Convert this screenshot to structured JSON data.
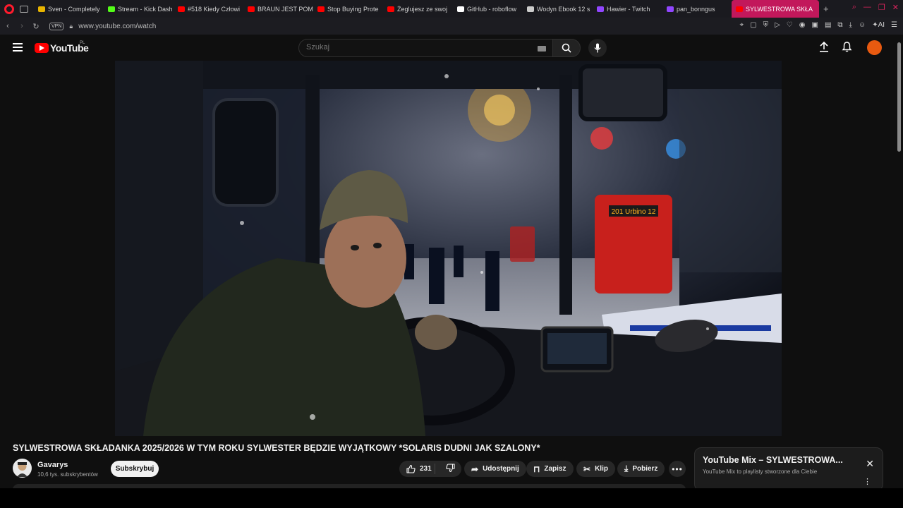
{
  "browser": {
    "tabs": [
      {
        "label": "Sven - Completely",
        "fav": "#e8b400"
      },
      {
        "label": "Stream - Kick Dash",
        "fav": "#53fc18"
      },
      {
        "label": "#518 Kiedy Człowi",
        "fav": "#ff0000"
      },
      {
        "label": "BRAUN JEST POM",
        "fav": "#ff0000"
      },
      {
        "label": "Stop Buying Prote",
        "fav": "#ff0000"
      },
      {
        "label": "Żeglujesz ze swoj",
        "fav": "#ff0000"
      },
      {
        "label": "GitHub - roboflow",
        "fav": "#ffffff"
      },
      {
        "label": "Wodyn Ebook 12 s",
        "fav": "#cccccc"
      },
      {
        "label": "Hawier - Twitch",
        "fav": "#9146ff"
      },
      {
        "label": "pan_bonngus",
        "fav": "#9146ff"
      }
    ],
    "active_tab": {
      "label": "SYLWESTROWA SKŁA",
      "fav": "#ff0000"
    },
    "url": "www.youtube.com/watch",
    "vpn_label": "VPN",
    "ai_label": "AI"
  },
  "youtube": {
    "logo_text": "YouTube",
    "region": "PL",
    "search_placeholder": "Szukaj"
  },
  "video": {
    "title": "SYLWESTROWA SKŁADANKA 2025/2026 W TYM ROKU SYLWESTER BĘDZIE WYJĄTKOWY *SOLARIS DUDNI JAK SZALONY*",
    "bus_sign": "201 Urbino 12"
  },
  "channel": {
    "name": "Gavarys",
    "subscribers": "10,6 tys. subskrybentów",
    "subscribe_label": "Subskrybuj"
  },
  "actions": {
    "likes": "231",
    "share": "Udostępnij",
    "save": "Zapisz",
    "clip": "Klip",
    "download": "Pobierz"
  },
  "mix": {
    "title": "YouTube Mix – SYLWESTROWA...",
    "subtitle": "YouTube Mix to playlisty stworzone dla Ciebie"
  }
}
